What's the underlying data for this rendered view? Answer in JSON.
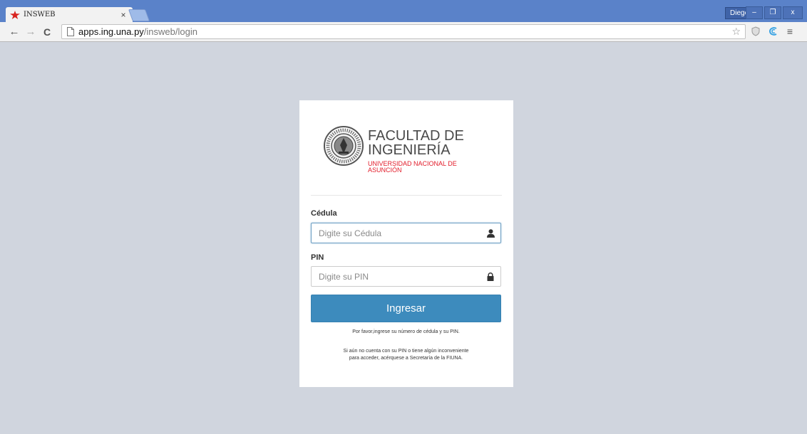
{
  "browser": {
    "tab_title": "INSWEB",
    "tab_close": "×",
    "user_name": "Diego",
    "url_host": "apps.ing.una.py",
    "url_path": "/insweb/login",
    "win_minimize": "–",
    "win_maximize": "❐",
    "win_close": "x",
    "back": "←",
    "forward": "→",
    "reload": "C",
    "star": "☆",
    "menu": "≡"
  },
  "logo": {
    "title_line1": "FACULTAD DE",
    "title_line2": "INGENIERÍA",
    "subtitle_line1": "UNIVERSIDAD NACIONAL DE",
    "subtitle_line2": "ASUNCIÓN"
  },
  "form": {
    "cedula_label": "Cédula",
    "cedula_placeholder": "Digite su Cédula",
    "cedula_value": "",
    "pin_label": "PIN",
    "pin_placeholder": "Digite su PIN",
    "pin_value": "",
    "submit_label": "Ingresar",
    "help_text_1": "Por favor,ingrese su número de cédula y su PIN.",
    "help_text_2_line1": "Si aún no cuenta con su PIN o tiene algún inconveniente",
    "help_text_2_line2": "para acceder, acérquese a Secretaría de la FIUNA."
  },
  "colors": {
    "titlebar": "#5a82c9",
    "page_bg": "#d0d5de",
    "primary_button": "#3d8bbd",
    "subtitle_red": "#e21c2a"
  },
  "icons": {
    "favicon": "red-star-icon",
    "cedula_field": "user-icon",
    "pin_field": "lock-icon"
  }
}
